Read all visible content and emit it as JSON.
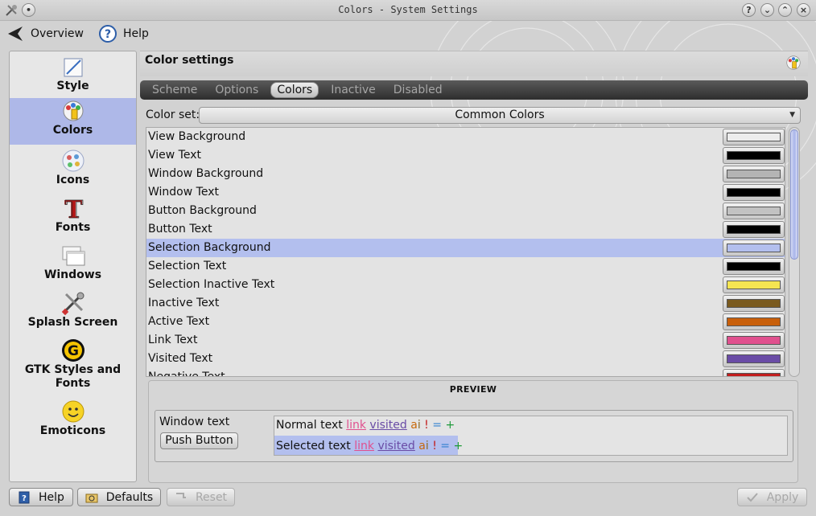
{
  "window": {
    "title": "Colors - System Settings"
  },
  "toolbar": {
    "overview_label": "Overview",
    "help_label": "Help"
  },
  "sidebar": {
    "items": [
      {
        "label": "Style",
        "icon": "style-icon"
      },
      {
        "label": "Colors",
        "icon": "colors-icon",
        "active": true
      },
      {
        "label": "Icons",
        "icon": "icons-icon"
      },
      {
        "label": "Fonts",
        "icon": "fonts-icon"
      },
      {
        "label": "Windows",
        "icon": "windows-icon"
      },
      {
        "label": "Splash Screen",
        "icon": "splash-screen-icon"
      },
      {
        "label": "GTK Styles and Fonts",
        "icon": "gtk-icon"
      },
      {
        "label": "Emoticons",
        "icon": "emoticons-icon"
      }
    ]
  },
  "main": {
    "heading": "Color settings",
    "tabs": [
      {
        "label": "Scheme"
      },
      {
        "label": "Options"
      },
      {
        "label": "Colors",
        "active": true
      },
      {
        "label": "Inactive"
      },
      {
        "label": "Disabled"
      }
    ],
    "color_set": {
      "label": "Color set:",
      "value": "Common Colors"
    },
    "color_roles": [
      {
        "label": "View Background",
        "color": "#ececec"
      },
      {
        "label": "View Text",
        "color": "#000000"
      },
      {
        "label": "Window Background",
        "color": "#b4b4b4"
      },
      {
        "label": "Window Text",
        "color": "#000000"
      },
      {
        "label": "Button Background",
        "color": "#c2c2c2"
      },
      {
        "label": "Button Text",
        "color": "#000000"
      },
      {
        "label": "Selection Background",
        "color": "#b3bfee",
        "selected": true
      },
      {
        "label": "Selection Text",
        "color": "#000000"
      },
      {
        "label": "Selection Inactive Text",
        "color": "#f5e552"
      },
      {
        "label": "Inactive Text",
        "color": "#7a5a1e"
      },
      {
        "label": "Active Text",
        "color": "#c85f0a"
      },
      {
        "label": "Link Text",
        "color": "#e0508e"
      },
      {
        "label": "Visited Text",
        "color": "#6a4ca6"
      },
      {
        "label": "Negative Text",
        "color": "#c21d1d"
      }
    ]
  },
  "preview": {
    "title": "PREVIEW",
    "window_text": "Window text",
    "push_button": "Push Button",
    "normal_text": "Normal text",
    "selected_text": "Selected text",
    "link": "link",
    "visited": "visited",
    "active": "a",
    "inactive": "i",
    "negative": "!",
    "neutral": "=",
    "positive": "+"
  },
  "bottom": {
    "help_label": "Help",
    "defaults_label": "Defaults",
    "reset_label": "Reset",
    "apply_label": "Apply"
  }
}
